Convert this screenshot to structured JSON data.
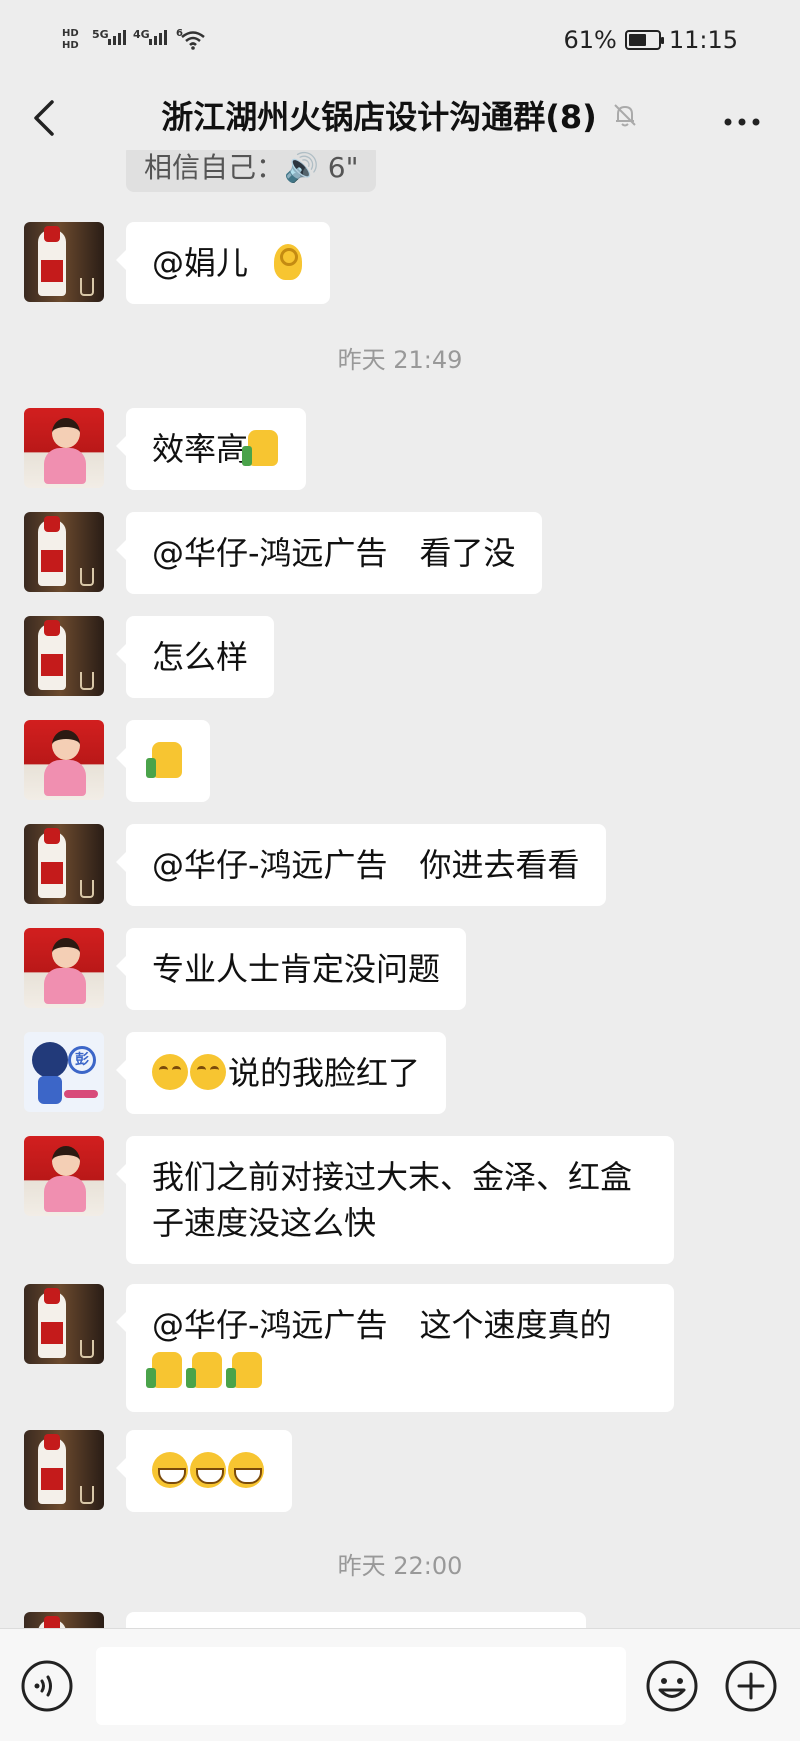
{
  "status_bar": {
    "sim1": "HD",
    "sim2": "HD",
    "net1": "5G",
    "net2": "4G",
    "net3": "6",
    "battery_percent": "61%",
    "battery_level": 0.61,
    "time": "11:15"
  },
  "nav": {
    "title": "浙江湖州火锅店设计沟通群(8)",
    "back_icon": "chevron-left-icon",
    "mute_icon": "bell-off-icon",
    "more_icon": "more-horizontal-icon"
  },
  "chat": {
    "voice_preview": "相信自己：🔊 6\"",
    "timestamps": [
      "昨天 21:49",
      "昨天 22:00"
    ],
    "messages": [
      {
        "avatar": "bottle",
        "text": "@娟儿",
        "emoji": [
          "ok"
        ]
      },
      {
        "avatar": "girl",
        "text": "效率高",
        "emoji": [
          "thumb"
        ]
      },
      {
        "avatar": "bottle",
        "text": "@华仔-鸿远广告　看了没",
        "emoji": []
      },
      {
        "avatar": "bottle",
        "text": "怎么样",
        "emoji": []
      },
      {
        "avatar": "girl",
        "text": "",
        "emoji": [
          "thumb"
        ]
      },
      {
        "avatar": "bottle",
        "text": "@华仔-鸿远广告　你进去看看",
        "emoji": []
      },
      {
        "avatar": "girl",
        "text": "专业人士肯定没问题",
        "emoji": []
      },
      {
        "avatar": "cartoon",
        "text": "说的我脸红了",
        "emoji": [
          "smile",
          "smile"
        ]
      },
      {
        "avatar": "girl",
        "text": "我们之前对接过大末、金泽、红盒子速度没这么快",
        "emoji": []
      },
      {
        "avatar": "bottle",
        "text": "@华仔-鸿远广告　这个速度真的",
        "emoji": [
          "thumb",
          "thumb",
          "thumb"
        ]
      },
      {
        "avatar": "bottle",
        "text": "",
        "emoji": [
          "grin",
          "grin",
          "grin"
        ]
      }
    ]
  },
  "input_bar": {
    "voice_icon": "voice-icon",
    "emoji_icon": "emoji-icon",
    "plus_icon": "plus-icon",
    "placeholder": ""
  }
}
